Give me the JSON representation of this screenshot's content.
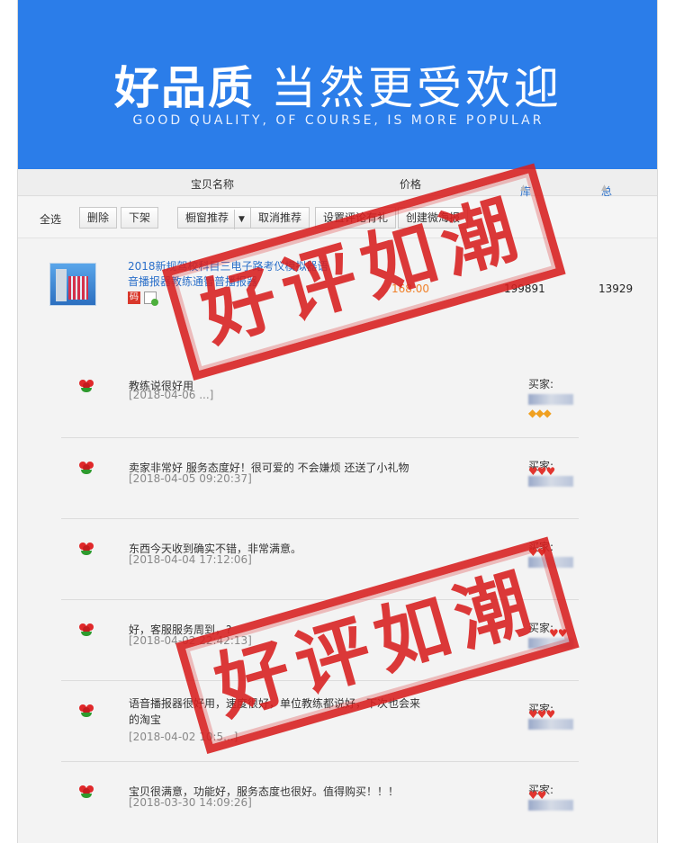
{
  "banner": {
    "title_bold": "好品质",
    "title_thin": "当然更受欢迎",
    "subtitle": "GOOD QUALITY, OF COURSE, IS MORE POPULAR"
  },
  "columns": {
    "name": "宝贝名称",
    "price": "价格",
    "stock": "库存",
    "sales": "总销量"
  },
  "toolbar": {
    "select_all": "全选",
    "delete": "删除",
    "unlist": "下架",
    "window_recommend": "橱窗推荐",
    "cancel_recommend": "取消推荐",
    "set_review_gift": "设置评论有礼",
    "create_poster": "创建微海报"
  },
  "product": {
    "name": "2018新规驾校科目三电子路考仪模拟器语音播报器教练通智普播报器",
    "badge": "码",
    "price": "168.00",
    "stock": "199891",
    "sales": "13929"
  },
  "reviews": [
    {
      "text": "教练说很好用",
      "date": "[2018-04-06 ...]",
      "buyer_label": "买家:",
      "rating": "◆◆◆"
    },
    {
      "text": "卖家非常好 服务态度好！很可爱的 不会嫌烦 还送了小礼物",
      "date": "[2018-04-05 09:20:37]",
      "buyer_label": "买家:",
      "rating": "♥♥♥"
    },
    {
      "text": "东西今天收到确实不错，非常满意。",
      "date": "[2018-04-04 17:12:06]",
      "buyer_label": "买家:",
      "rating": "♥♥"
    },
    {
      "text": "好，客服服务周到，?",
      "date": "[2018-04-02 22:42:13]",
      "buyer_label": "买家:",
      "rating": "♥♥"
    },
    {
      "text": "语音播报器很好用，速度很好，单位教练都说好，下次也会来",
      "text2": "的淘宝",
      "date": "[2018-04-02 10:5...]",
      "buyer_label": "买家:",
      "rating": "♥♥♥"
    },
    {
      "text": "宝贝很满意，功能好，服务态度也很好。值得购买！！！",
      "date": "[2018-03-30 14:09:26]",
      "buyer_label": "买家:",
      "rating": "♥♥"
    }
  ],
  "stamp": {
    "text": "好评如潮",
    "color": "#d81f1f"
  }
}
